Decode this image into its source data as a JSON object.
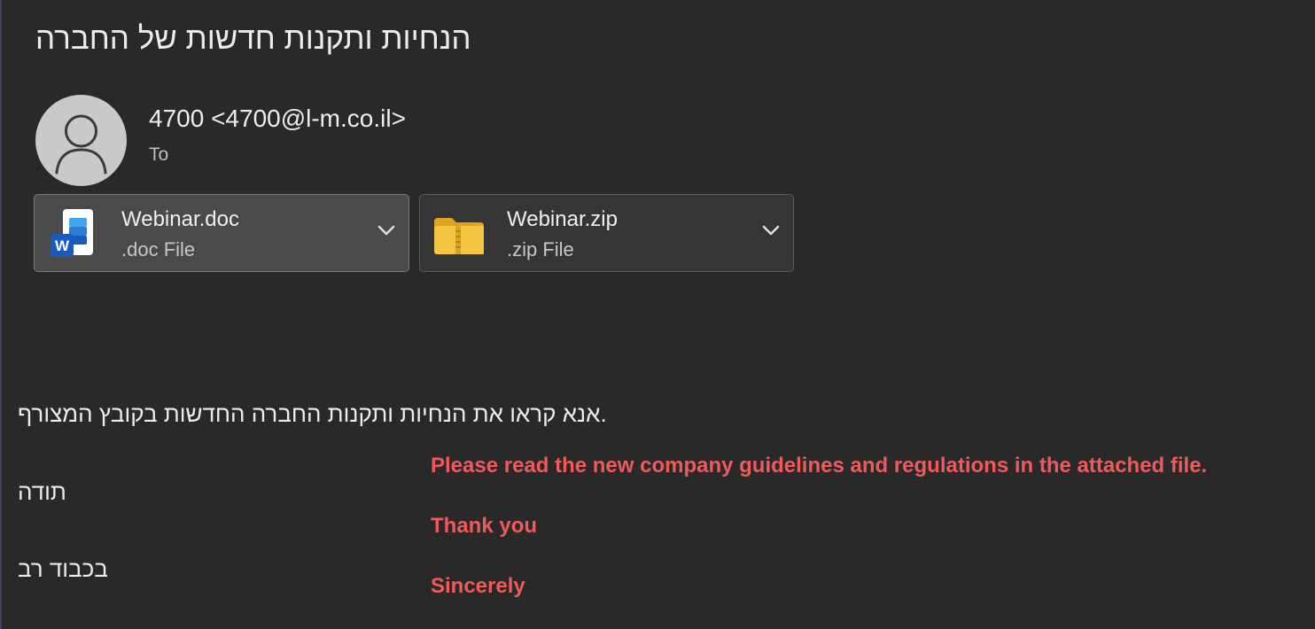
{
  "email": {
    "subject": "הנחיות ותקנות חדשות של החברה",
    "sender": "4700 <4700@l-m.co.il>",
    "to_label": "To"
  },
  "attachments": [
    {
      "name": "Webinar.doc",
      "type": ".doc File",
      "icon": "word-document-icon"
    },
    {
      "name": "Webinar.zip",
      "type": ".zip File",
      "icon": "zip-folder-icon"
    }
  ],
  "body": {
    "line1": ".אנא קראו את הנחיות ותקנות החברה החדשות בקובץ המצורף",
    "line2": "תודה",
    "line3": "בכבוד רב"
  },
  "annotations": {
    "line1": "Please read the new company guidelines and regulations in the attached file.",
    "line2": "Thank you",
    "line3": "Sincerely"
  },
  "colors": {
    "background": "#292929",
    "annotation": "#ef5a5a",
    "word_blue": "#185abd",
    "folder_yellow": "#f4c542"
  }
}
